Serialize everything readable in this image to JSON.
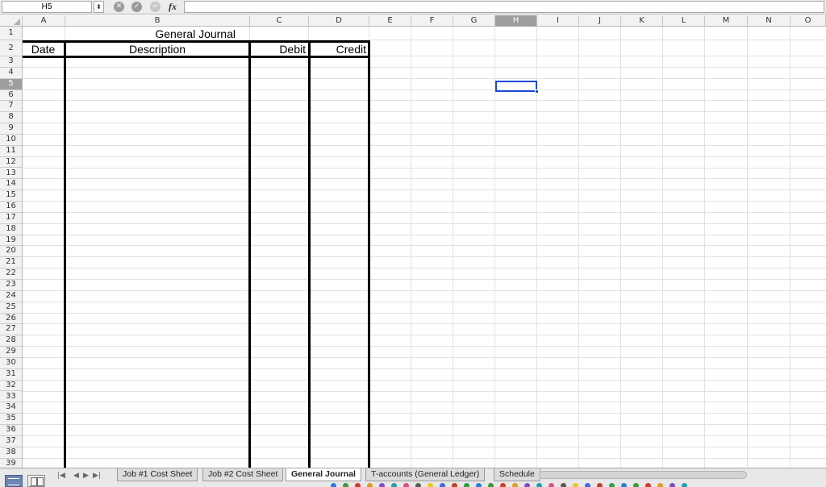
{
  "formula_bar": {
    "name_box": "H5",
    "fx_label": "fx",
    "formula": ""
  },
  "columns": [
    "A",
    "B",
    "C",
    "D",
    "E",
    "F",
    "G",
    "H",
    "I",
    "J",
    "K",
    "L",
    "M",
    "N",
    "O"
  ],
  "selected_column": "H",
  "selected_row": "5",
  "rows": [
    "1",
    "2",
    "3",
    "4",
    "5",
    "6",
    "7",
    "8",
    "9",
    "10",
    "11",
    "12",
    "13",
    "14",
    "15",
    "16",
    "17",
    "18",
    "19",
    "20",
    "21",
    "22",
    "23",
    "24",
    "25",
    "26",
    "27",
    "28",
    "29",
    "30",
    "31",
    "32",
    "33",
    "34",
    "35",
    "36",
    "37",
    "38",
    "39"
  ],
  "sheet": {
    "title": "General Journal",
    "headers": {
      "date": "Date",
      "description": "Description",
      "debit": "Debit",
      "credit": "Credit"
    },
    "selected_cell": "H5"
  },
  "tab_bar": {
    "tabs": [
      {
        "label": "Job #1 Cost Sheet",
        "active": false
      },
      {
        "label": "Job #2 Cost Sheet",
        "active": false
      },
      {
        "label": "General Journal",
        "active": true
      },
      {
        "label": "T-accounts (General Ledger)",
        "active": false
      },
      {
        "label": "Schedule",
        "active": false
      }
    ],
    "nav_first": "|◀",
    "nav_prev": "◀",
    "nav_next": "▶",
    "nav_last": "▶|"
  },
  "icons": {
    "cancel": "✕",
    "confirm": "✓",
    "function": "=",
    "stepper": "⬍"
  },
  "colors": {
    "selection": "#1c4dd8",
    "header_selected": "#9e9e9e"
  }
}
